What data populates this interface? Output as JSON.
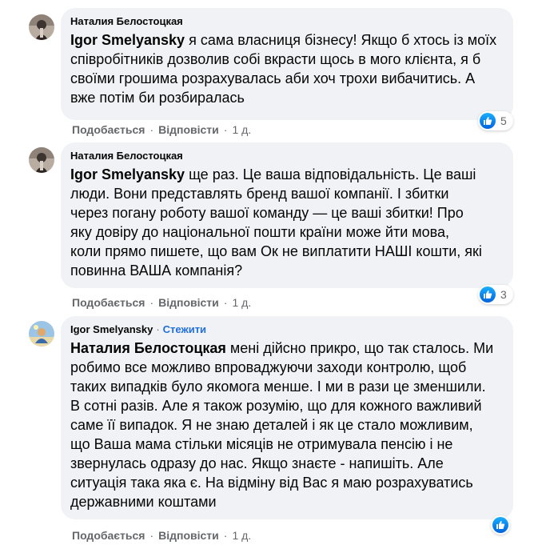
{
  "colors": {
    "bubble": "#f0f2f5",
    "text": "#050505",
    "meta": "#65676b",
    "follow": "#216fdb",
    "like": "#1877f2"
  },
  "comments": [
    {
      "author": "Наталия Белостоцкая",
      "mention": "Igor Smelyansky",
      "lines": [
        " я сама власниця бізнесу! Якщо б хтось із моїх",
        "співробітників дозволив собі вкрасти щось в мого клієнта, я б",
        "своїми грошима розрахувалась аби хоч трохи вибачитись. А",
        "вже потім би розбиралась"
      ],
      "like_label": "Подобається",
      "reply_label": "Відповісти",
      "time": "1 д.",
      "reaction_icon": "like-icon",
      "reaction_count": "5"
    },
    {
      "author": "Наталия Белостоцкая",
      "mention": "Igor Smelyansky",
      "lines": [
        " ще раз. Це ваша відповідальність. Це ваші",
        "люди. Вони представлять бренд вашої компанії. І збитки",
        "через погану роботу вашої команду — це ваші збитки! Про",
        "яку довіру до національної пошти країни може йти мова,",
        "коли прямо пишете, що вам Ок не виплатити НАШІ кошти, які",
        "повинна ВАША компанія?"
      ],
      "like_label": "Подобається",
      "reply_label": "Відповісти",
      "time": "1 д.",
      "reaction_icon": "like-icon",
      "reaction_count": "3"
    },
    {
      "author": "Igor Smelyansky",
      "follow_label": "Стежити",
      "mention": "Наталия Белостоцкая",
      "lines": [
        " мені дійсно прикро, що так сталось. Ми",
        "робимо все можливо впроваджуючи заходи контролю, щоб",
        "таких випадків було якомога менше. І ми в рази це зменшили.",
        "В сотні разів. Але я також розумію, що для кожного важливий",
        "саме її випадок. Я не знаю деталей і як це стало можливим,",
        "що Ваша мама стільки місяців не отримувала пенсію і не",
        "звернулась одразу до нас. Якщо знаєте - напишіть. Але",
        "ситуація така яка є. На відміну від Вас я маю розрахуватись",
        "державними коштами"
      ],
      "like_label": "Подобається",
      "reply_label": "Відповісти",
      "time": "1 д.",
      "reaction_icon": "like-icon"
    }
  ]
}
